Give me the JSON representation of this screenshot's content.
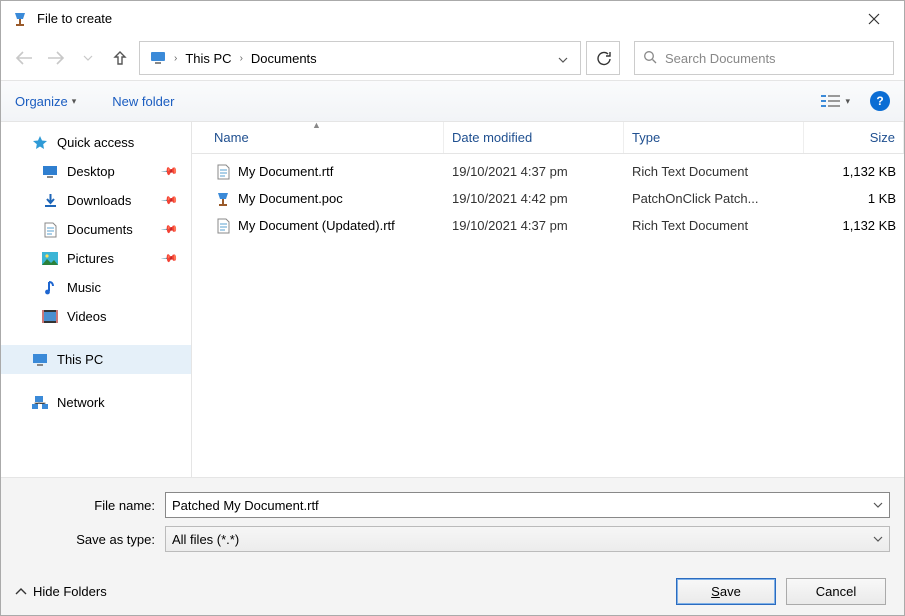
{
  "title": "File to create",
  "breadcrumb": {
    "root": "This PC",
    "folder": "Documents"
  },
  "search": {
    "placeholder": "Search Documents"
  },
  "toolbar": {
    "organize": "Organize",
    "newfolder": "New folder"
  },
  "side": {
    "quick": "Quick access",
    "desktop": "Desktop",
    "downloads": "Downloads",
    "documents": "Documents",
    "pictures": "Pictures",
    "music": "Music",
    "videos": "Videos",
    "thispc": "This PC",
    "network": "Network"
  },
  "cols": {
    "name": "Name",
    "date": "Date modified",
    "type": "Type",
    "size": "Size"
  },
  "files": [
    {
      "name": "My Document.rtf",
      "date": "19/10/2021 4:37 pm",
      "type": "Rich Text Document",
      "size": "1,132 KB",
      "icon": "rtf"
    },
    {
      "name": "My Document.poc",
      "date": "19/10/2021 4:42 pm",
      "type": "PatchOnClick Patch...",
      "size": "1 KB",
      "icon": "poc"
    },
    {
      "name": "My Document (Updated).rtf",
      "date": "19/10/2021 4:37 pm",
      "type": "Rich Text Document",
      "size": "1,132 KB",
      "icon": "rtf"
    }
  ],
  "form": {
    "filename_label": "File name:",
    "filename_value": "Patched My Document.rtf",
    "type_label": "Save as type:",
    "type_value": "All files (*.*)",
    "hide": "Hide Folders",
    "save": "Save",
    "cancel": "Cancel"
  }
}
